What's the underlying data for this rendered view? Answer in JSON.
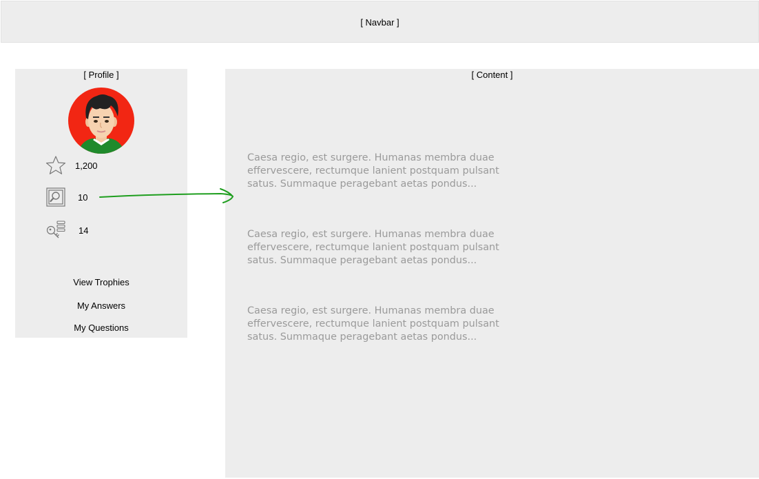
{
  "navbar": {
    "label": "[ Navbar ]"
  },
  "profile": {
    "label": "[ Profile ]",
    "stats": {
      "reputation": "1,200",
      "answers": "10",
      "questions": "14"
    },
    "links": {
      "trophies": "View Trophies",
      "answers": "My Answers",
      "questions": "My Questions"
    }
  },
  "content": {
    "label": "[ Content ]",
    "excerpts": [
      "Caesa regio, est surgere. Humanas membra duae effervescere, rectumque lanient postquam pulsant satus. Summaque peragebant aetas pondus...",
      "Caesa regio, est surgere. Humanas membra duae effervescere, rectumque lanient postquam pulsant satus. Summaque peragebant aetas pondus...",
      "Caesa regio, est surgere. Humanas membra duae effervescere, rectumque lanient postquam pulsant satus. Summaque peragebant aetas pondus..."
    ]
  },
  "icons": {
    "reputation": "star-icon",
    "answers": "search-document-icon",
    "questions": "key-list-icon"
  },
  "colors": {
    "panel": "#ededed",
    "excerpt_text": "#9a9a9a",
    "arrow": "#1e9e1e",
    "avatar_bg": "#f22613"
  }
}
